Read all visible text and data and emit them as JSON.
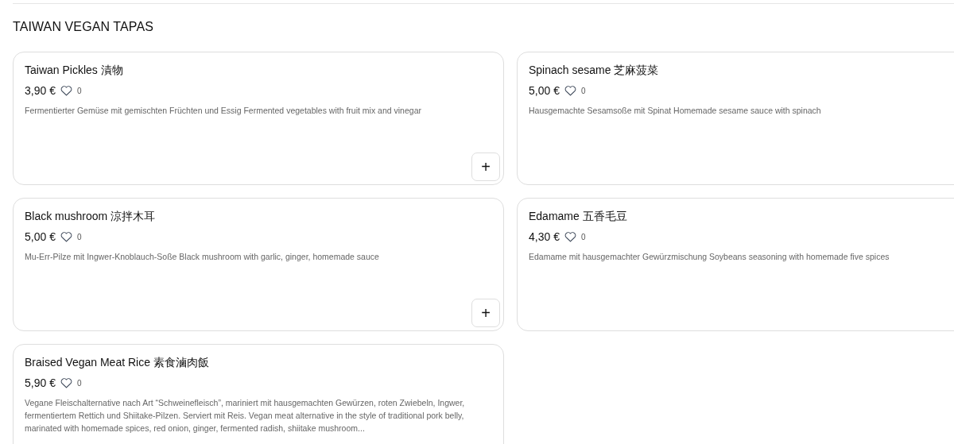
{
  "section_title": "TAIWAN VEGAN TAPAS",
  "dishes": [
    {
      "name": "Taiwan Pickles 漬物",
      "price": "3,90 €",
      "likes": "0",
      "description": "Fermentierter Gemüse mit gemischten Früchten und Essig Fermented vegetables with fruit mix and vinegar",
      "add_label": "+"
    },
    {
      "name": "Spinach sesame 芝麻菠菜",
      "price": "5,00 €",
      "likes": "0",
      "description": "Hausgemachte Sesamsoße mit Spinat Homemade sesame sauce with spinach"
    },
    {
      "name": "Black mushroom 涼拌木耳",
      "price": "5,00 €",
      "likes": "0",
      "description": "Mu-Err-Pilze mit Ingwer-Knoblauch-Soße Black mushroom with garlic, ginger, homemade sauce",
      "add_label": "+"
    },
    {
      "name": "Edamame 五香毛豆",
      "price": "4,30 €",
      "likes": "0",
      "description": "Edamame mit hausgemachter Gewürzmischung Soybeans seasoning with homemade five spices"
    },
    {
      "name": "Braised Vegan Meat Rice 素食滷肉飯",
      "price": "5,90 €",
      "likes": "0",
      "description": "Vegane Fleischalternative nach Art “Schweinefleisch”, mariniert mit hausgemachten Gewürzen, roten Zwiebeln, Ingwer, fermentiertem Rettich und Shiitake-Pilzen. Serviert mit Reis. Vegan meat alternative in the style of traditional pork belly, marinated with homemade spices, red onion, ginger, fermented radish, shiitake mushroom..."
    }
  ]
}
